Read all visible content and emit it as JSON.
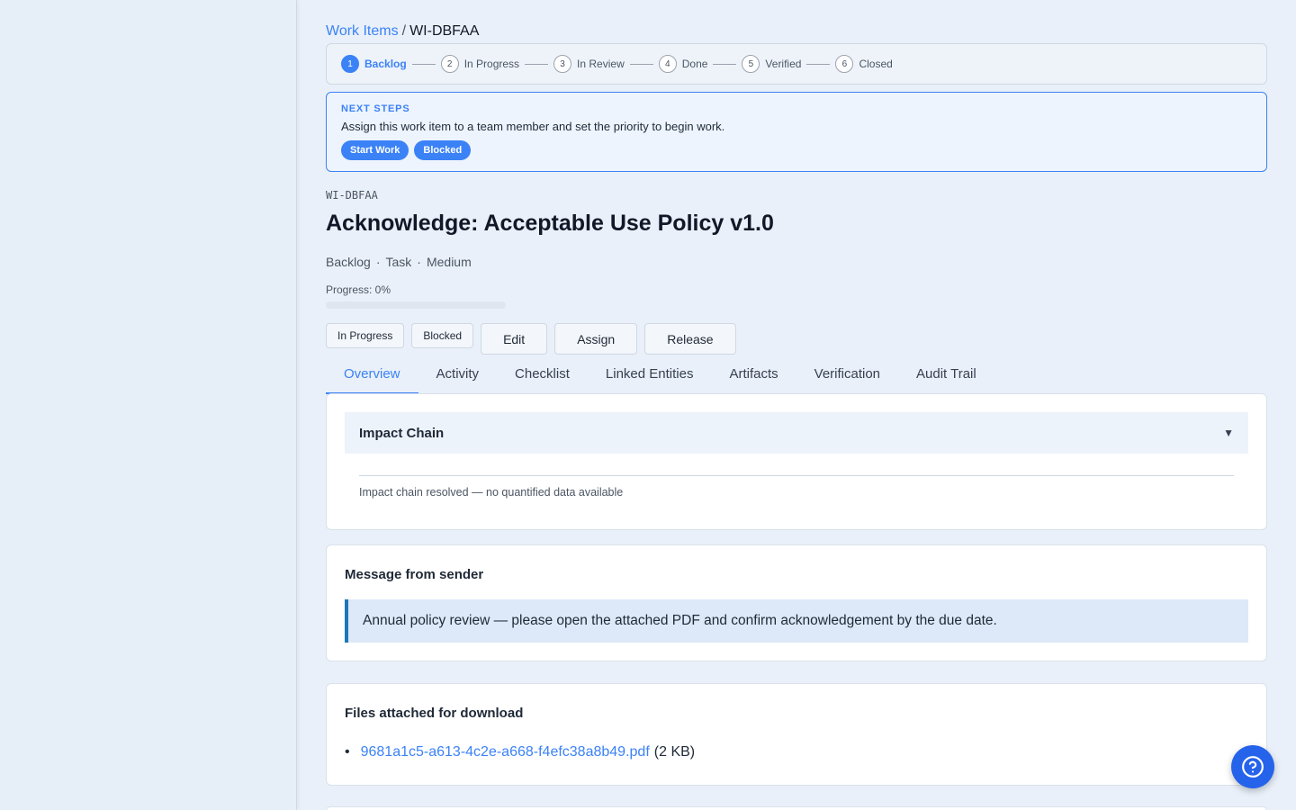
{
  "breadcrumb": {
    "parent": "Work Items",
    "separator": "/",
    "current": "WI-DBFAA"
  },
  "stepper": {
    "steps": [
      {
        "num": "1",
        "label": "Backlog",
        "active": true
      },
      {
        "num": "2",
        "label": "In Progress"
      },
      {
        "num": "3",
        "label": "In Review"
      },
      {
        "num": "4",
        "label": "Done"
      },
      {
        "num": "5",
        "label": "Verified"
      },
      {
        "num": "6",
        "label": "Closed"
      }
    ]
  },
  "next_steps": {
    "title": "NEXT STEPS",
    "description": "Assign this work item to a team member and set the priority to begin work.",
    "buttons": [
      "Start Work",
      "Blocked"
    ]
  },
  "work_item": {
    "id": "WI-DBFAA",
    "title": "Acknowledge: Acceptable Use Policy v1.0",
    "status": "Backlog",
    "type": "Task",
    "priority": "Medium",
    "meta_dot": "·",
    "progress_label": "Progress: 0%",
    "progress_fraction": 0
  },
  "actions": {
    "in_progress": "In Progress",
    "blocked": "Blocked",
    "edit": "Edit",
    "assign": "Assign",
    "release": "Release"
  },
  "tabs": [
    "Overview",
    "Activity",
    "Checklist",
    "Linked Entities",
    "Artifacts",
    "Verification",
    "Audit Trail"
  ],
  "impact_chain": {
    "title": "Impact Chain",
    "caret": "▼",
    "text": "Impact chain resolved — no quantified data available"
  },
  "message": {
    "title": "Message from sender",
    "body": "Annual policy review — please open the attached PDF and confirm acknowledgement by the due date."
  },
  "files": {
    "title": "Files attached for download",
    "bullet": "•",
    "items": [
      {
        "name": "9681a1c5-a613-4c2e-a668-f4efc38a8b49.pdf",
        "size": "(2 KB)"
      }
    ]
  },
  "colors": {
    "accent": "#3b82f6",
    "fab": "#2563eb",
    "quote_border": "#1d76b8"
  },
  "icons": {
    "help": "help-circle-icon",
    "caret": "chevron-down-icon"
  }
}
